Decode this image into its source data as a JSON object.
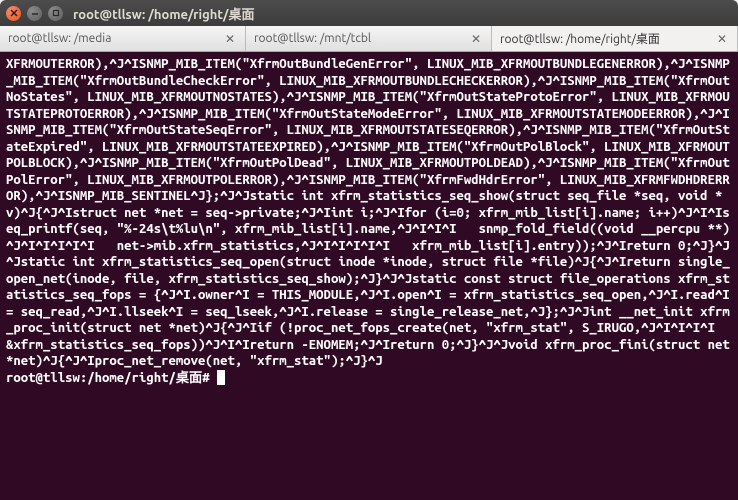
{
  "window": {
    "title": "root@tllsw: /home/right/桌面"
  },
  "tabs": [
    {
      "label": "root@tllsw: /media",
      "active": false
    },
    {
      "label": "root@tllsw: /mnt/tcbl",
      "active": false
    },
    {
      "label": "root@tllsw: /home/right/桌面",
      "active": true
    }
  ],
  "terminal": {
    "content": "XFRMOUTERROR),^J^ISNMP_MIB_ITEM(\"XfrmOutBundleGenError\", LINUX_MIB_XFRMOUTBUNDLEGENERROR),^J^ISNMP_MIB_ITEM(\"XfrmOutBundleCheckError\", LINUX_MIB_XFRMOUTBUNDLECHECKERROR),^J^ISNMP_MIB_ITEM(\"XfrmOutNoStates\", LINUX_MIB_XFRMOUTNOSTATES),^J^ISNMP_MIB_ITEM(\"XfrmOutStateProtoError\", LINUX_MIB_XFRMOUTSTATEPROTOERROR),^J^ISNMP_MIB_ITEM(\"XfrmOutStateModeError\", LINUX_MIB_XFRMOUTSTATEMODEERROR),^J^ISNMP_MIB_ITEM(\"XfrmOutStateSeqError\", LINUX_MIB_XFRMOUTSTATESEQERROR),^J^ISNMP_MIB_ITEM(\"XfrmOutStateExpired\", LINUX_MIB_XFRMOUTSTATEEXPIRED),^J^ISNMP_MIB_ITEM(\"XfrmOutPolBlock\", LINUX_MIB_XFRMOUTPOLBLOCK),^J^ISNMP_MIB_ITEM(\"XfrmOutPolDead\", LINUX_MIB_XFRMOUTPOLDEAD),^J^ISNMP_MIB_ITEM(\"XfrmOutPolError\", LINUX_MIB_XFRMOUTPOLERROR),^J^ISNMP_MIB_ITEM(\"XfrmFwdHdrError\", LINUX_MIB_XFRMFWDHDRERROR),^J^ISNMP_MIB_SENTINEL^J};^J^Jstatic int xfrm_statistics_seq_show(struct seq_file *seq, void *v)^J{^J^Istruct net *net = seq->private;^J^Iint i;^J^Ifor (i=0; xfrm_mib_list[i].name; i++)^J^I^Iseq_printf(seq, \"%-24s\\t%lu\\n\", xfrm_mib_list[i].name,^J^I^I^I   snmp_fold_field((void __percpu **)^J^I^I^I^I^I   net->mib.xfrm_statistics,^J^I^I^I^I^I   xfrm_mib_list[i].entry));^J^Ireturn 0;^J}^J^Jstatic int xfrm_statistics_seq_open(struct inode *inode, struct file *file)^J{^J^Ireturn single_open_net(inode, file, xfrm_statistics_seq_show);^J}^J^Jstatic const struct file_operations xfrm_statistics_seq_fops = {^J^I.owner^I = THIS_MODULE,^J^I.open^I = xfrm_statistics_seq_open,^J^I.read^I = seq_read,^J^I.llseek^I = seq_lseek,^J^I.release = single_release_net,^J};^J^Jint __net_init xfrm_proc_init(struct net *net)^J{^J^Iif (!proc_net_fops_create(net, \"xfrm_stat\", S_IRUGO,^J^I^I^I^I  &xfrm_statistics_seq_fops))^J^I^Ireturn -ENOMEM;^J^Ireturn 0;^J}^J^Jvoid xfrm_proc_fini(struct net *net)^J{^J^Iproc_net_remove(net, \"xfrm_stat\");^J}^J",
    "prompt": "root@tllsw:/home/right/桌面# "
  }
}
